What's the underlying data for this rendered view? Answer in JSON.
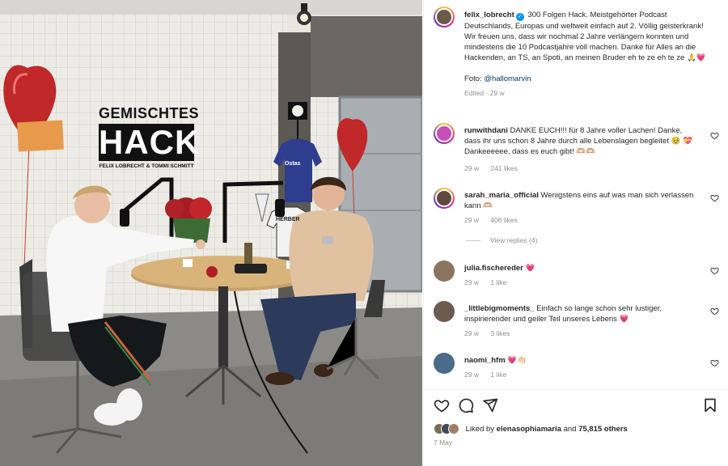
{
  "photo": {
    "sign_top": "GEMISCHTES",
    "sign_main": "HACK",
    "sign_sub": "FELIX LOBRECHT & TOMMI SCHMITT",
    "jersey_text": "Ostas",
    "jersey2_text": "HERBER"
  },
  "post": {
    "username": "felix_lobrecht",
    "caption": "300 Folgen Hack. Meistgehörter Podcast Deutschlands, Europas und weltweit einfach auf 2. Völlig geisterkrank! Wir freuen uns, dass wir nochmal 2 Jahre verlängern konnten und mindestens die 10 Podcastjahre voll machen. Danke für Alles an die Hackenden, an TS, an Spoti, an meinen Bruder eh te ze eh te ze 🙏💗",
    "photo_credit_label": "Foto:",
    "photo_credit_handle": "@hallomarvin",
    "edited": "Edited · 29 w"
  },
  "comments": [
    {
      "username": "runwithdani",
      "text": "DANKE EUCH!!! für 8 Jahre voller Lachen! Danke, dass ihr uns schon 8 Jahre durch alle Lebenslagen begleitet 🥹 💝 Dankeeeeee, dass es euch gibt! 🫶🏼🫶🏼",
      "time": "29 w",
      "likes": "241 likes",
      "color": "#c94fb8"
    },
    {
      "username": "sarah_maria_official",
      "text": "Wenigstens eins auf was man sich verlassen kann 🫶🏼",
      "time": "29 w",
      "likes": "406 likes",
      "color": "#5b4a3e"
    },
    {
      "username": "julia.fischereder",
      "text": "💗",
      "time": "29 w",
      "likes": "1 like",
      "color": "#8a7460"
    },
    {
      "username": "_littlebigmoments_",
      "text": "Einfach so lange schon sehr lustiger, inspirierender und geiler Teil unseres Lebens 💗",
      "time": "29 w",
      "likes": "3 likes",
      "color": "#6d5b4f"
    },
    {
      "username": "naomi_hfm",
      "text": "💗👏🏻",
      "time": "29 w",
      "likes": "1 like",
      "color": "#4a6b8a"
    }
  ],
  "view_replies": "View replies (4)",
  "likes": {
    "prefix": "Liked by",
    "user": "elenasophiamaria",
    "and": "and",
    "others": "75,815 others"
  },
  "date": "7 May",
  "colors": {
    "link": "#00376b",
    "verified": "#0095f6",
    "muted": "#8e8e8e"
  }
}
